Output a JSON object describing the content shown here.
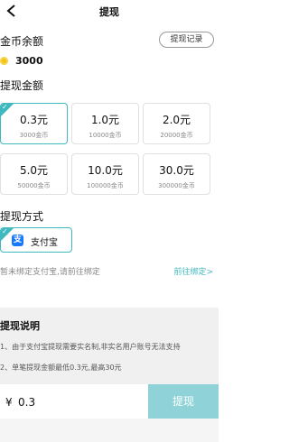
{
  "nav": {
    "title": "提现"
  },
  "balance": {
    "label": "金币余额",
    "record_button": "提现记录",
    "coins": "3000"
  },
  "amount": {
    "label": "提现金额",
    "options": [
      {
        "value": "0.3元",
        "coins": "3000金币",
        "selected": true
      },
      {
        "value": "1.0元",
        "coins": "10000金币",
        "selected": false
      },
      {
        "value": "2.0元",
        "coins": "20000金币",
        "selected": false
      },
      {
        "value": "5.0元",
        "coins": "50000金币",
        "selected": false
      },
      {
        "value": "10.0元",
        "coins": "100000金币",
        "selected": false
      },
      {
        "value": "30.0元",
        "coins": "300000金币",
        "selected": false
      }
    ]
  },
  "method": {
    "label": "提现方式",
    "alipay": "支付宝",
    "alipay_glyph": "支"
  },
  "bind": {
    "hint": "暂未绑定支付宝,请前往绑定",
    "link": "前往绑定>"
  },
  "notes": {
    "title": "提现说明",
    "items": [
      "1、由于支付宝提现需要实名制,非实名用户账号无法支持",
      "2、单笔提现金额最低0.3元,最高30元"
    ]
  },
  "footer": {
    "currency": "¥",
    "amount": "0.3",
    "submit": "提现"
  },
  "colors": {
    "accent": "#3fb8bf",
    "submit_bg": "#8fd3d8",
    "alipay_blue": "#1677ff",
    "coin": "#f4c21b"
  }
}
